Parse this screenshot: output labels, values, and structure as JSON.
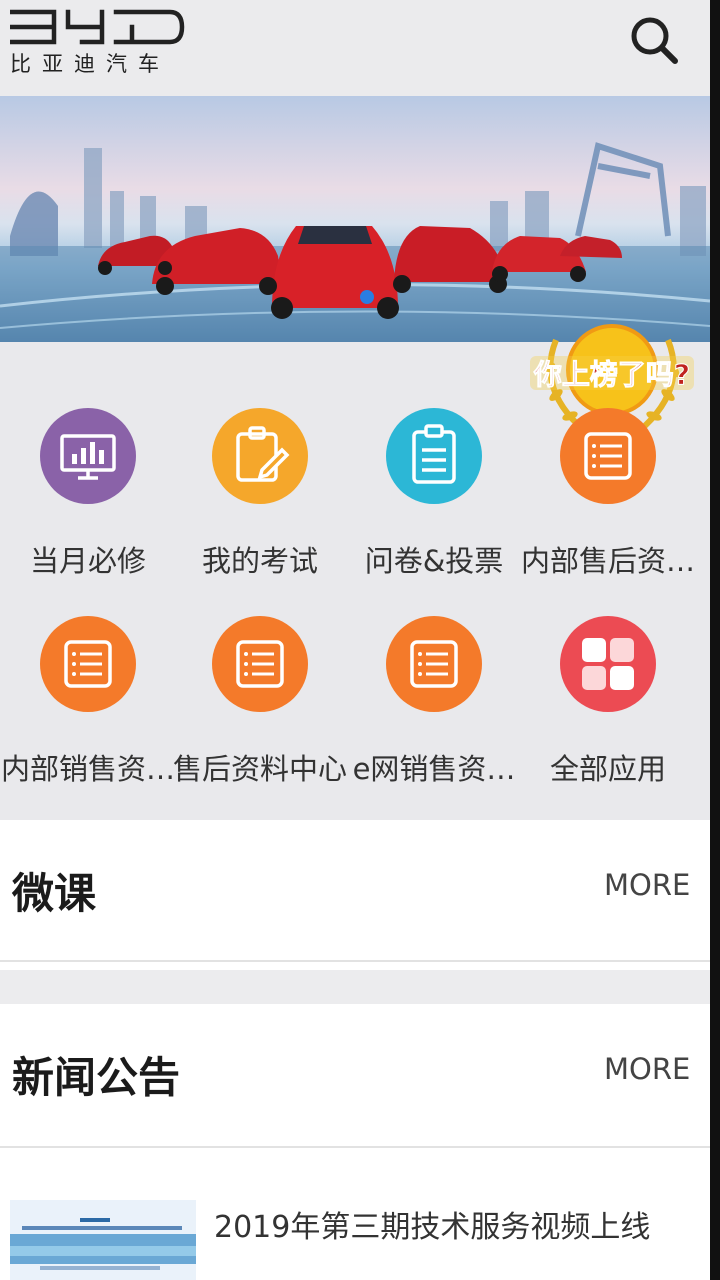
{
  "header": {
    "brand_sub": "比亚迪汽车",
    "search_icon": "search-icon"
  },
  "banner": {
    "badge_text": "你上榜了吗?"
  },
  "apps": [
    {
      "label": "当月必修",
      "icon": "chart-monitor-icon",
      "color": "#8a62a8"
    },
    {
      "label": "我的考试",
      "icon": "clipboard-pen-icon",
      "color": "#f5a72b"
    },
    {
      "label": "问卷&投票",
      "icon": "clipboard-list-icon",
      "color": "#2cb7d6"
    },
    {
      "label": "内部售后资…",
      "icon": "document-list-icon",
      "color": "#f47a2a"
    },
    {
      "label": "内部销售资…",
      "icon": "document-list-icon",
      "color": "#f47a2a"
    },
    {
      "label": "售后资料中心",
      "icon": "document-list-icon",
      "color": "#f47a2a"
    },
    {
      "label": "e网销售资…",
      "icon": "document-list-icon",
      "color": "#f47a2a"
    },
    {
      "label": "全部应用",
      "icon": "grid-apps-icon",
      "color": "#ec4b53"
    }
  ],
  "sections": {
    "microcourse": {
      "title": "微课",
      "more": "MORE"
    },
    "news": {
      "title": "新闻公告",
      "more": "MORE"
    }
  },
  "news_items": [
    {
      "title": "2019年第三期技术服务视频上线"
    }
  ]
}
